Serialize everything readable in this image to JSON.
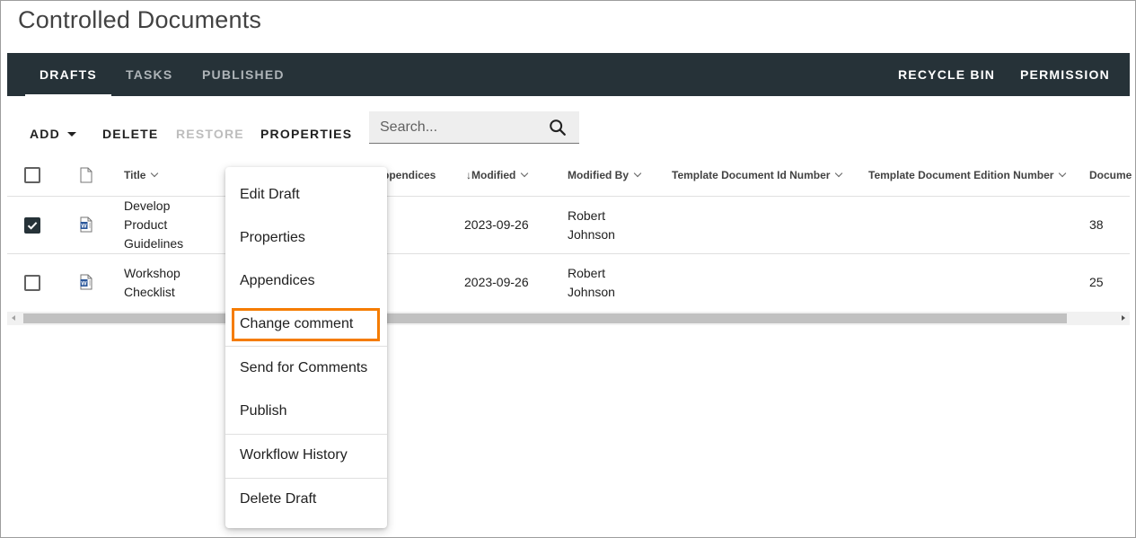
{
  "page": {
    "title": "Controlled Documents"
  },
  "navbar": {
    "tabs": [
      {
        "label": "DRAFTS",
        "active": true
      },
      {
        "label": "TASKS",
        "active": false
      },
      {
        "label": "PUBLISHED",
        "active": false
      }
    ],
    "right_items": [
      {
        "label": "RECYCLE BIN"
      },
      {
        "label": "PERMISSION"
      }
    ],
    "background_color": "#263238"
  },
  "toolbar": {
    "add_label": "ADD",
    "delete_label": "DELETE",
    "restore_label": "RESTORE",
    "properties_label": "PROPERTIES",
    "search_placeholder": "Search..."
  },
  "table": {
    "columns": [
      {
        "label": "Title"
      },
      {
        "label": "ppendices"
      },
      {
        "label": "Modified",
        "sort": "descending"
      },
      {
        "label": "Modified By"
      },
      {
        "label": "Template Document Id Number"
      },
      {
        "label": "Template Document Edition Number"
      },
      {
        "label": "Docume"
      }
    ],
    "rows": [
      {
        "checked": true,
        "icon": "word-document-icon",
        "title_lines": [
          "Develop",
          "Product",
          "Guidelines"
        ],
        "modified": "2023-09-26",
        "modified_by_lines": [
          "Robert",
          "Johnson"
        ],
        "document": "38"
      },
      {
        "checked": false,
        "icon": "word-document-icon",
        "title_lines": [
          "Workshop",
          "Checklist"
        ],
        "modified": "2023-09-26",
        "modified_by_lines": [
          "Robert",
          "Johnson"
        ],
        "document": "25"
      }
    ]
  },
  "context_menu": {
    "items": [
      {
        "label": "Edit Draft"
      },
      {
        "label": "Properties"
      },
      {
        "label": "Appendices"
      },
      {
        "label": "Change comment",
        "highlighted": true
      },
      {
        "label": "Send for Comments"
      },
      {
        "label": "Publish"
      },
      {
        "label": "Workflow History"
      },
      {
        "label": "Delete Draft"
      }
    ],
    "highlight_color": "#f57c00"
  }
}
